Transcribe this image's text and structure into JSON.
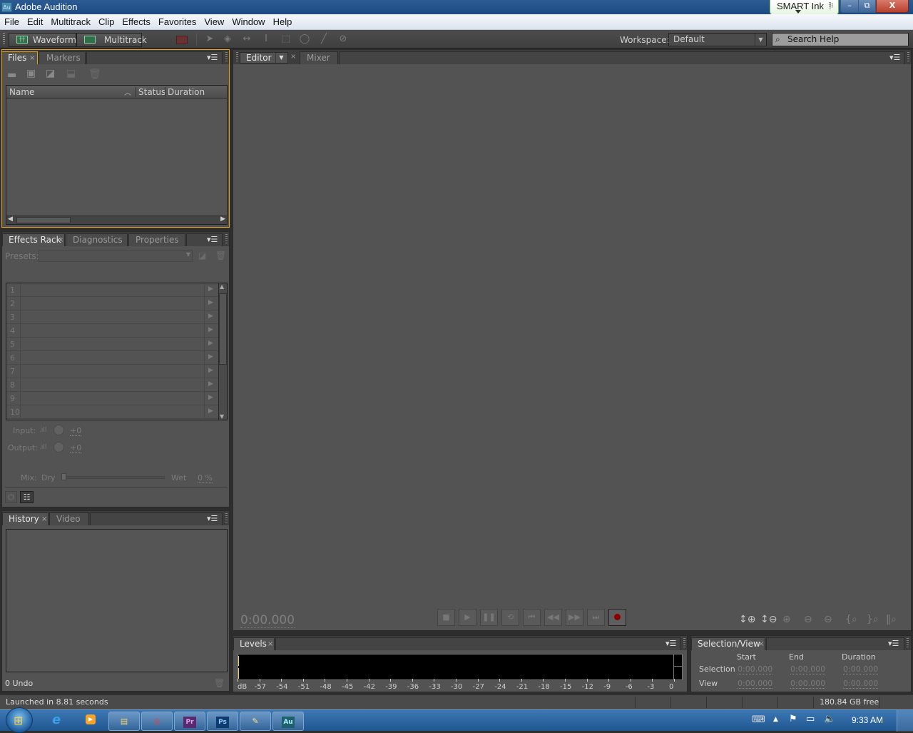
{
  "window": {
    "title": "Adobe Audition",
    "app_icon": "Au",
    "smart_ink_label": "SMART Ink",
    "controls": {
      "minimize": "–",
      "maximize": "⧉",
      "close": "X"
    }
  },
  "menu": [
    "File",
    "Edit",
    "Multitrack",
    "Clip",
    "Effects",
    "Favorites",
    "View",
    "Window",
    "Help"
  ],
  "toolbar": {
    "waveform_label": "Waveform",
    "multitrack_label": "Multitrack",
    "tools": [
      "spectral-display-icon",
      "move-tool-icon",
      "razor-tool-icon",
      "slip-tool-icon",
      "time-selection-tool-icon",
      "marquee-tool-icon",
      "lasso-tool-icon",
      "brush-tool-icon",
      "spot-healing-icon"
    ],
    "workspace_label": "Workspace:",
    "workspace_value": "Default",
    "search_placeholder": "Search Help"
  },
  "files_panel": {
    "tabs": [
      "Files",
      "Markers"
    ],
    "columns": [
      "Name",
      "Status",
      "Duration"
    ],
    "toolbar_icons": [
      "open-file-icon",
      "import-file-icon",
      "new-file-icon",
      "insert-into-multitrack-icon",
      "delete-icon"
    ]
  },
  "effects_panel": {
    "tabs": [
      "Effects Rack",
      "Diagnostics",
      "Properties"
    ],
    "presets_label": "Presets:",
    "presets_value": "",
    "slots": [
      "1",
      "2",
      "3",
      "4",
      "5",
      "6",
      "7",
      "8",
      "9",
      "10"
    ],
    "input_label": "Input:",
    "input_value": "+0",
    "output_label": "Output:",
    "output_value": "+0",
    "mix_label": "Mix:",
    "dry_label": "Dry",
    "wet_label": "Wet",
    "mix_value": "0 %",
    "mix_fraction": 0
  },
  "history_panel": {
    "tabs": [
      "History",
      "Video"
    ],
    "undo_count": "0 Undo"
  },
  "editor_panel": {
    "tabs": [
      "Editor",
      "Mixer"
    ],
    "time_display": "0:00.000",
    "transport": [
      "stop",
      "play",
      "pause",
      "loop",
      "go-to-start",
      "rewind",
      "fast-forward",
      "go-to-end",
      "record"
    ],
    "zoom_controls": [
      "zoom-in-amplitude",
      "zoom-out-amplitude",
      "zoom-in-time",
      "zoom-out-time",
      "zoom-out-full",
      "zoom-in-at-in-point",
      "zoom-in-at-out-point",
      "zoom-to-selection"
    ]
  },
  "levels_panel": {
    "title": "Levels",
    "scale": [
      "dB",
      "-57",
      "-54",
      "-51",
      "-48",
      "-45",
      "-42",
      "-39",
      "-36",
      "-33",
      "-30",
      "-27",
      "-24",
      "-21",
      "-18",
      "-15",
      "-12",
      "-9",
      "-6",
      "-3",
      "0"
    ]
  },
  "selection_panel": {
    "title": "Selection/View",
    "columns": [
      "Start",
      "End",
      "Duration"
    ],
    "rows": [
      {
        "label": "Selection",
        "start": "0:00.000",
        "end": "0:00.000",
        "duration": "0:00.000"
      },
      {
        "label": "View",
        "start": "0:00.000",
        "end": "0:00.000",
        "duration": "0:00.000"
      }
    ]
  },
  "status_bar": {
    "message": "Launched in 8.81 seconds",
    "disk_free": "180.84 GB free"
  },
  "taskbar": {
    "apps": [
      {
        "name": "internet-explorer",
        "glyph": "e"
      },
      {
        "name": "media-player",
        "glyph": "▶"
      },
      {
        "name": "file-explorer",
        "glyph": "▤"
      },
      {
        "name": "chrome",
        "glyph": "◎"
      },
      {
        "name": "premiere",
        "glyph": "Pr"
      },
      {
        "name": "photoshop",
        "glyph": "Ps"
      },
      {
        "name": "paint",
        "glyph": "✎"
      },
      {
        "name": "audition",
        "glyph": "Au"
      }
    ],
    "clock": "9:33 AM"
  },
  "colors": {
    "panel_bg": "#535353",
    "active_panel_border": "#e8a317",
    "record": "#8b0000",
    "meter_peak": "#ffd800"
  }
}
